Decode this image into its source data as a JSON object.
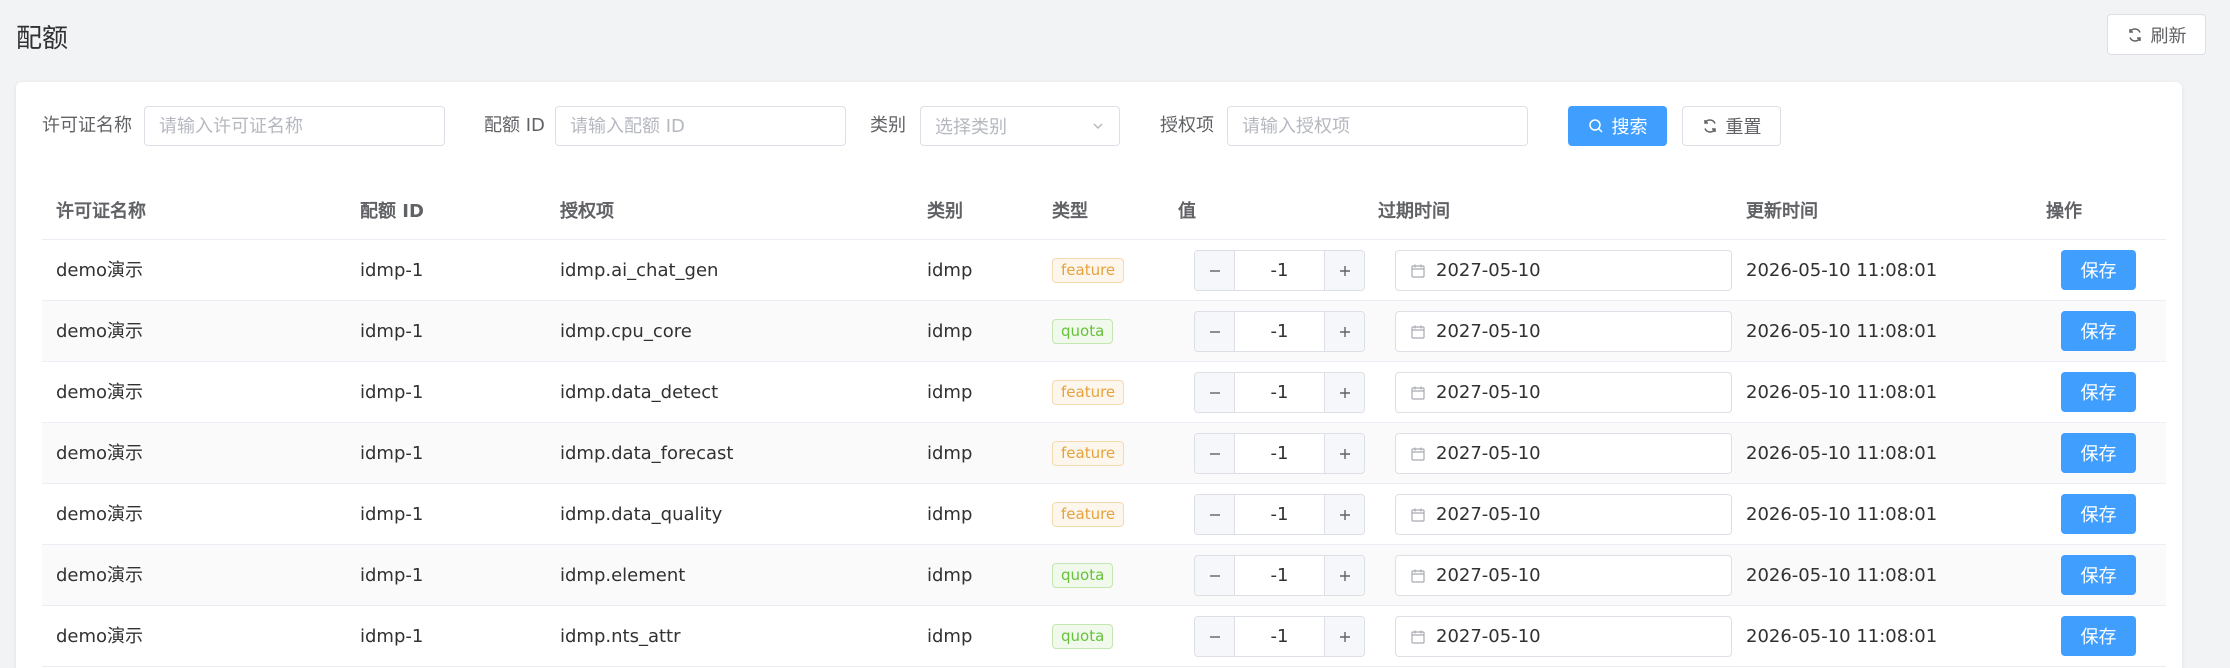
{
  "page": {
    "title": "配额"
  },
  "toolbar": {
    "refresh_label": "刷新"
  },
  "filters": {
    "license_name_label": "许可证名称",
    "license_name_placeholder": "请输入许可证名称",
    "quota_id_label": "配额 ID",
    "quota_id_placeholder": "请输入配额 ID",
    "category_label": "类别",
    "category_placeholder": "选择类别",
    "grant_label": "授权项",
    "grant_placeholder": "请输入授权项",
    "search_label": "搜索",
    "reset_label": "重置"
  },
  "table": {
    "headers": [
      "许可证名称",
      "配额 ID",
      "授权项",
      "类别",
      "类型",
      "值",
      "过期时间",
      "更新时间",
      "操作"
    ],
    "save_label": "保存",
    "rows": [
      {
        "license": "demo演示",
        "quota_id": "idmp-1",
        "grant": "idmp.ai_chat_gen",
        "category": "idmp",
        "type": "feature",
        "value": "-1",
        "expire": "2027-05-10",
        "updated": "2026-05-10 11:08:01"
      },
      {
        "license": "demo演示",
        "quota_id": "idmp-1",
        "grant": "idmp.cpu_core",
        "category": "idmp",
        "type": "quota",
        "value": "-1",
        "expire": "2027-05-10",
        "updated": "2026-05-10 11:08:01"
      },
      {
        "license": "demo演示",
        "quota_id": "idmp-1",
        "grant": "idmp.data_detect",
        "category": "idmp",
        "type": "feature",
        "value": "-1",
        "expire": "2027-05-10",
        "updated": "2026-05-10 11:08:01"
      },
      {
        "license": "demo演示",
        "quota_id": "idmp-1",
        "grant": "idmp.data_forecast",
        "category": "idmp",
        "type": "feature",
        "value": "-1",
        "expire": "2027-05-10",
        "updated": "2026-05-10 11:08:01"
      },
      {
        "license": "demo演示",
        "quota_id": "idmp-1",
        "grant": "idmp.data_quality",
        "category": "idmp",
        "type": "feature",
        "value": "-1",
        "expire": "2027-05-10",
        "updated": "2026-05-10 11:08:01"
      },
      {
        "license": "demo演示",
        "quota_id": "idmp-1",
        "grant": "idmp.element",
        "category": "idmp",
        "type": "quota",
        "value": "-1",
        "expire": "2027-05-10",
        "updated": "2026-05-10 11:08:01"
      },
      {
        "license": "demo演示",
        "quota_id": "idmp-1",
        "grant": "idmp.nts_attr",
        "category": "idmp",
        "type": "quota",
        "value": "-1",
        "expire": "2027-05-10",
        "updated": "2026-05-10 11:08:01"
      }
    ]
  },
  "colors": {
    "primary": "#409eff",
    "feature_tag": "#e6a23c",
    "quota_tag": "#67c23a"
  }
}
